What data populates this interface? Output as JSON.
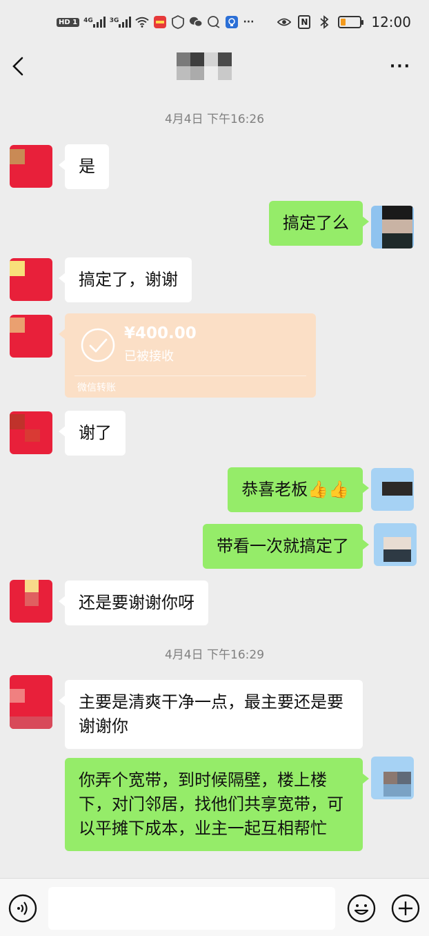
{
  "status_bar": {
    "hd_badge": "HD",
    "sim_slot": "1",
    "net_1": "4G",
    "net_2": "3G",
    "nfc": "N",
    "time": "12:00",
    "battery_level": 0.25,
    "icons": [
      "hd-icon",
      "signal-4g-icon",
      "signal-3g-icon",
      "wifi-icon",
      "app-notification-icon",
      "shield-icon",
      "wechat-icon",
      "bubble-icon",
      "lightbulb-icon",
      "overflow-dots-icon",
      "eye-icon",
      "nfc-icon",
      "bluetooth-icon",
      "battery-icon"
    ]
  },
  "header": {
    "back_icon": "chevron-left-icon",
    "more_label": "···"
  },
  "messages": [
    {
      "type": "timestamp",
      "text": "4月4日 下午16:26"
    },
    {
      "type": "text",
      "side": "in",
      "text": "是"
    },
    {
      "type": "text",
      "side": "out",
      "text": "搞定了么"
    },
    {
      "type": "text",
      "side": "in",
      "text": "搞定了，谢谢"
    },
    {
      "type": "transfer",
      "side": "in",
      "amount": "¥400.00",
      "status": "已被接收",
      "source": "微信转账"
    },
    {
      "type": "text",
      "side": "in",
      "text": "谢了"
    },
    {
      "type": "text",
      "side": "out",
      "text": "恭喜老板👍👍"
    },
    {
      "type": "text",
      "side": "out",
      "text": "带看一次就搞定了"
    },
    {
      "type": "text",
      "side": "in",
      "text": "还是要谢谢你呀"
    },
    {
      "type": "timestamp",
      "text": "4月4日 下午16:29"
    },
    {
      "type": "text",
      "side": "in",
      "text": "主要是清爽干净一点，最主要还是要谢谢你"
    },
    {
      "type": "text",
      "side": "out",
      "text": "你弄个宽带，到时候隔壁，楼上楼下，对门邻居，找他们共享宽带，可以平摊下成本，业主一起互相帮忙"
    }
  ],
  "input_bar": {
    "placeholder": "",
    "icons": [
      "voice-icon",
      "emoji-icon",
      "plus-icon"
    ]
  },
  "colors": {
    "background": "#ededed",
    "incoming_bubble": "#ffffff",
    "outgoing_bubble": "#95ec69",
    "transfer_card": "#fbdfc6",
    "timestamp_text": "#7f7f7f"
  }
}
